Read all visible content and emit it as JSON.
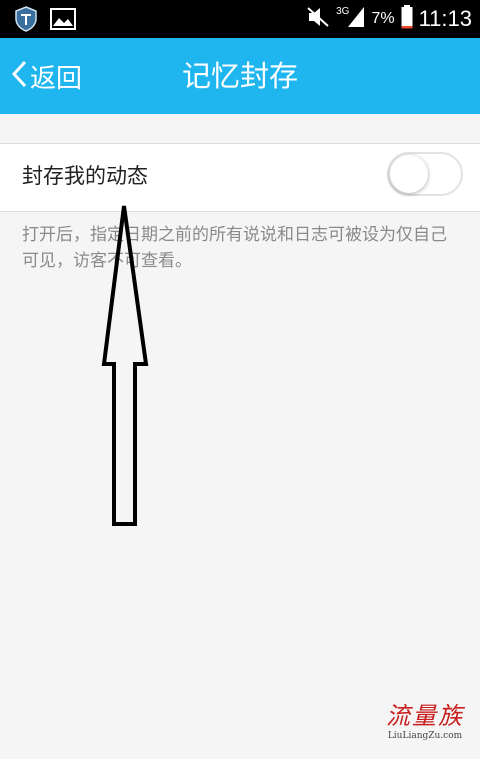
{
  "status_bar": {
    "network": "3G",
    "battery_percent": "7%",
    "battery_level": 0.07,
    "time": "11:13",
    "icons": [
      "shield-app-icon",
      "image-notification-icon",
      "mute-icon",
      "signal-icon",
      "battery-icon"
    ]
  },
  "header": {
    "back_label": "返回",
    "title": "记忆封存"
  },
  "setting": {
    "label": "封存我的动态",
    "toggle_on": false,
    "description": "打开后，指定日期之前的所有说说和日志可被设为仅自己可见，访客不可查看。"
  },
  "watermark": {
    "logo": "流量族",
    "url": "LiuLiangZu.com"
  },
  "colors": {
    "header": "#1fb6f0",
    "background": "#f5f5f5",
    "status_bar": "#000000",
    "battery_low": "#f04a2a",
    "watermark": "#c81e1e"
  }
}
